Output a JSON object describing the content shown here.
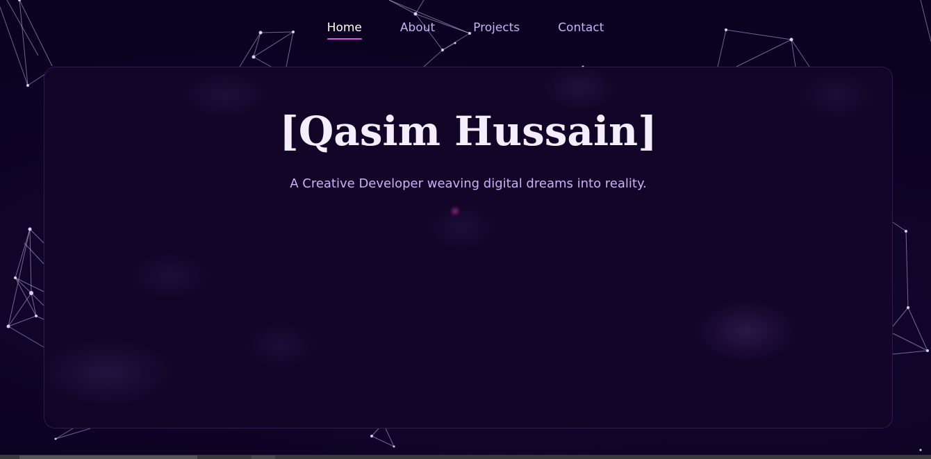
{
  "nav": {
    "items": [
      {
        "label": "Home",
        "active": true
      },
      {
        "label": "About",
        "active": false
      },
      {
        "label": "Projects",
        "active": false
      },
      {
        "label": "Contact",
        "active": false
      }
    ]
  },
  "hero": {
    "title": "[Qasim Hussain]",
    "subtitle": "A Creative Developer weaving digital dreams into reality."
  },
  "colors": {
    "background": "#0b0222",
    "card": "#12062a",
    "accent_underline": "#d45ce0",
    "nav_text": "#c6b1f2",
    "title_text": "#f4eefc",
    "subtitle_text": "#c8b3f3"
  }
}
